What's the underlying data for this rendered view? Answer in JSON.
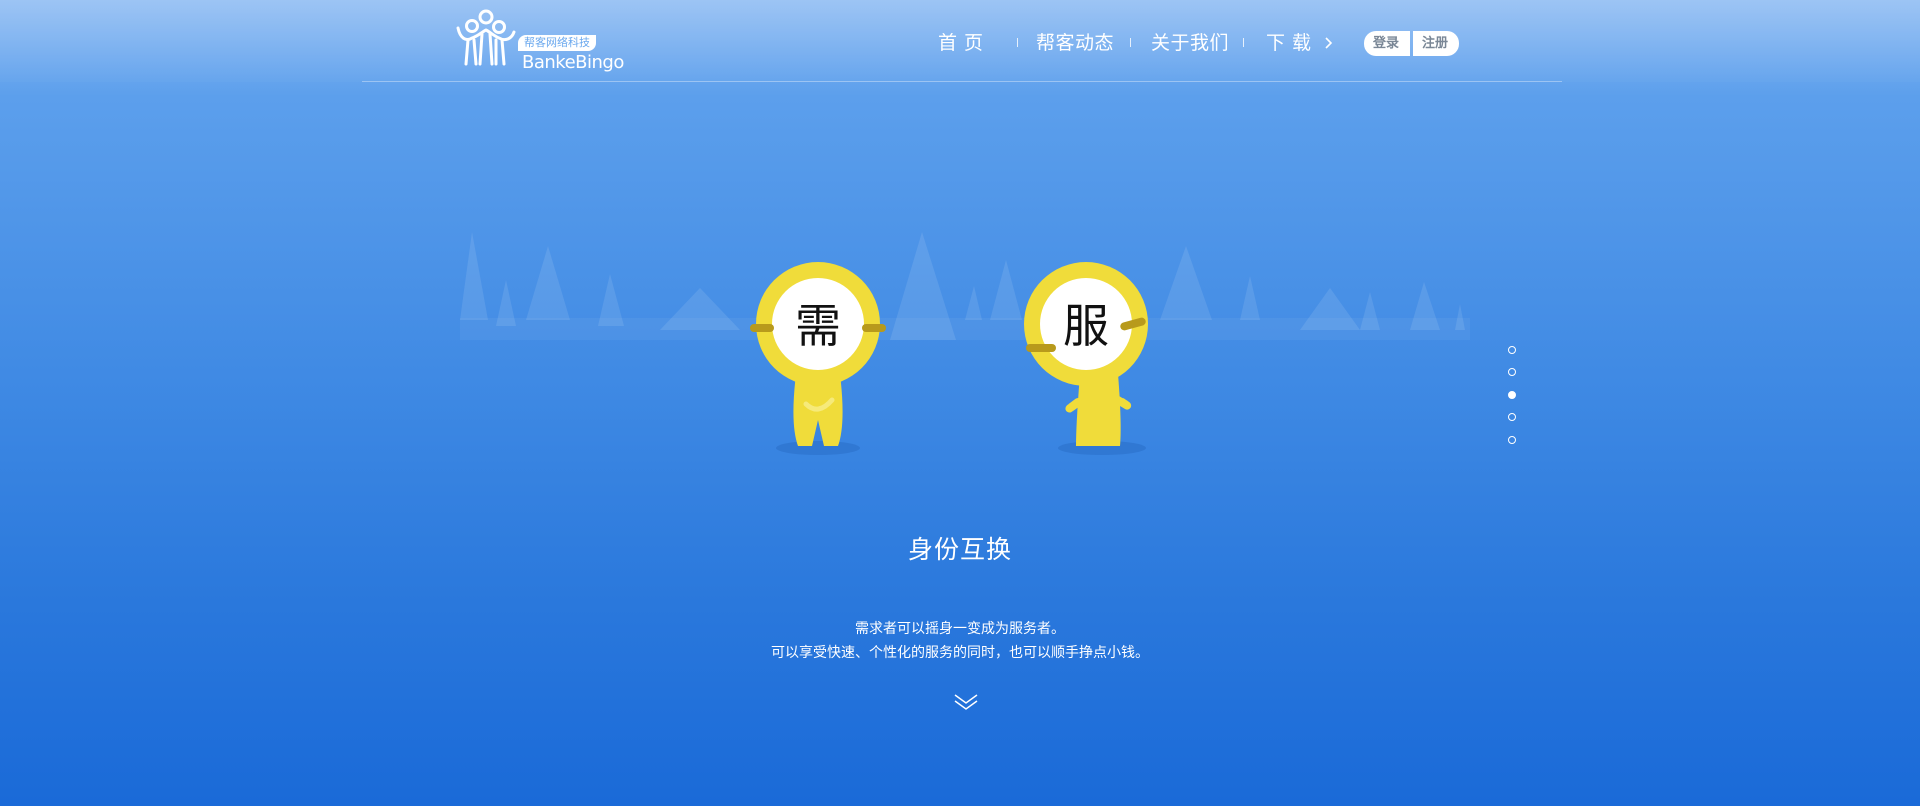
{
  "brand": {
    "logo_badge": "帮客网络科技",
    "logo_name": "BankeBingo"
  },
  "nav": {
    "items": [
      {
        "label": "首 页"
      },
      {
        "label": "帮客动态"
      },
      {
        "label": "关于我们"
      },
      {
        "label": "下 载"
      }
    ]
  },
  "auth": {
    "login_label": "登录",
    "register_label": "注册"
  },
  "hero": {
    "char_left": "需",
    "char_right": "服",
    "title": "身份互换",
    "desc_line1": "需求者可以摇身一变成为服务者。",
    "desc_line2": "可以享受快速、个性化的服务的同时，也可以顺手挣点小钱。"
  },
  "pager": {
    "count": 5,
    "active_index": 2
  },
  "colors": {
    "bg_top": "#8fbcf3",
    "bg_bottom": "#1a6ad8",
    "character_yellow": "#f0dc3a",
    "button_text": "#7a8796"
  },
  "icons": {
    "download_chevron": "chevron-right-icon",
    "scroll_down": "double-chevron-down-icon"
  }
}
